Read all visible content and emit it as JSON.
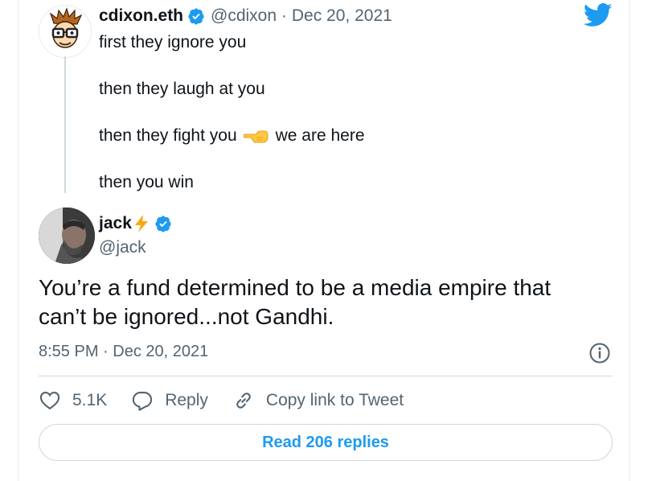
{
  "colors": {
    "accent": "#1d9bf0",
    "text": "#0f1419",
    "secondary": "#536471",
    "border": "#cfd9de",
    "bolt": "#f7a814"
  },
  "quoted_tweet": {
    "author_name": "cdixon.eth",
    "author_handle": "@cdixon",
    "date": "· Dec 20, 2021",
    "lines": {
      "line1": "first they ignore you",
      "line2": "then they laugh at you",
      "line3": "then they fight you",
      "line3_tail": "we are here",
      "line4": "then you win"
    },
    "emoji": "pointing-left-hand-icon"
  },
  "tweet": {
    "author_name": "jack",
    "author_handle": "@jack",
    "name_emoji": "lightning-bolt-icon",
    "text_line1": "You’re a fund determined to be a media empire that",
    "text_line2": "can’t be ignored...not Gandhi.",
    "timestamp": "8:55 PM · Dec 20, 2021"
  },
  "actions": {
    "like_count": "5.1K",
    "reply_label": "Reply",
    "copy_label": "Copy link to Tweet"
  },
  "read_replies_label": "Read 206 replies",
  "icons": [
    "twitter-logo-icon",
    "verified-badge-icon",
    "info-icon",
    "heart-icon",
    "reply-icon",
    "link-icon"
  ]
}
